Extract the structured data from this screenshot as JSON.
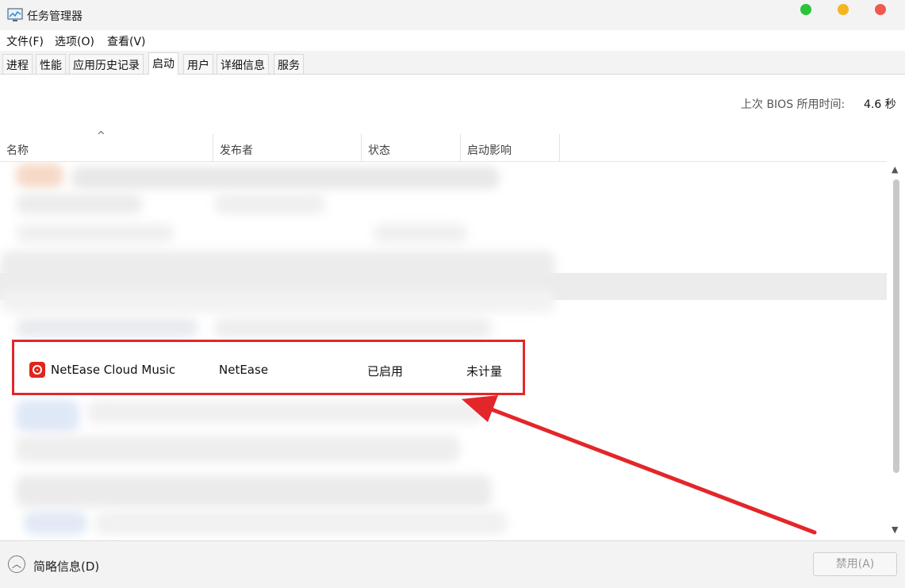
{
  "window": {
    "title": "任务管理器",
    "controls": [
      "green",
      "yellow",
      "red"
    ]
  },
  "menu": {
    "file": "文件(F)",
    "options": "选项(O)",
    "view": "查看(V)"
  },
  "tabs": [
    "进程",
    "性能",
    "应用历史记录",
    "启动",
    "用户",
    "详细信息",
    "服务"
  ],
  "active_tab": "启动",
  "bios": {
    "label": "上次 BIOS 所用时间:",
    "value": "4.6 秒"
  },
  "columns": {
    "name": "名称",
    "publisher": "发布者",
    "status": "状态",
    "impact": "启动影响"
  },
  "highlighted_row": {
    "icon": "netease-cloud-music-icon",
    "name": "NetEase Cloud Music",
    "publisher": "NetEase",
    "status": "已启用",
    "impact": "未计量"
  },
  "footer": {
    "fewer_details": "简略信息(D)",
    "disable_button": "禁用(A)"
  },
  "colors": {
    "annotation_red": "#e3262a",
    "app_icon_red": "#e1251b"
  }
}
